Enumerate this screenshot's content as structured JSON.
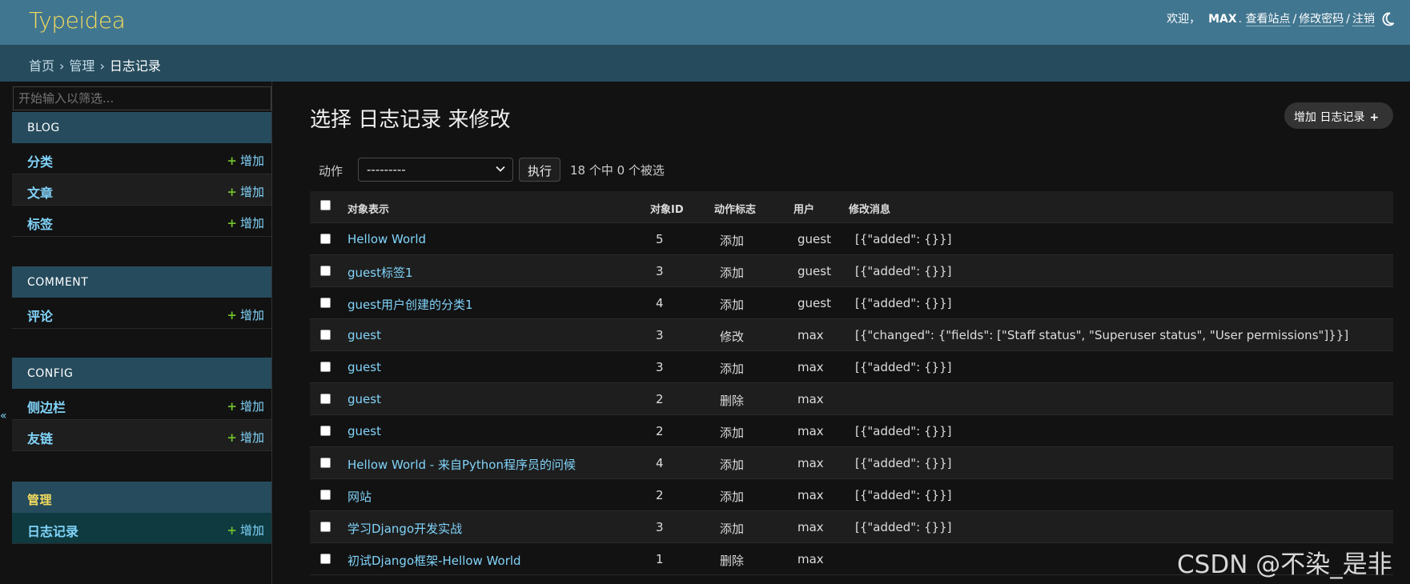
{
  "header": {
    "brand": "Typeidea",
    "welcome": "欢迎，",
    "username": "MAX",
    "view_site": "查看站点",
    "change_password": "修改密码",
    "logout": "注销",
    "sep": "/"
  },
  "breadcrumbs": {
    "home": "首页",
    "admin": "管理",
    "current": "日志记录",
    "arrow": "›"
  },
  "sidebar": {
    "filter_placeholder": "开始输入以筛选...",
    "collapse_glyph": "«",
    "add_label": "增加",
    "plus": "+",
    "modules": [
      {
        "caption": "BLOG",
        "items": [
          {
            "name": "分类"
          },
          {
            "name": "文章"
          },
          {
            "name": "标签"
          }
        ]
      },
      {
        "caption": "COMMENT",
        "items": [
          {
            "name": "评论"
          }
        ]
      },
      {
        "caption": "CONFIG",
        "items": [
          {
            "name": "侧边栏"
          },
          {
            "name": "友链"
          }
        ]
      },
      {
        "caption": "管理",
        "items": [
          {
            "name": "日志记录"
          }
        ]
      }
    ]
  },
  "main": {
    "title": "选择 日志记录 来修改",
    "add_button": "增加 日志记录",
    "add_plus": "+",
    "actions_label": "动作",
    "action_selected": "---------",
    "go_button": "执行",
    "selection_count": "18 个中 0 个被选",
    "columns": [
      "对象表示",
      "对象ID",
      "动作标志",
      "用户",
      "修改消息"
    ],
    "rows": [
      {
        "repr": "Hellow World",
        "id": "5",
        "flag": "添加",
        "user": "guest",
        "msg": "[{\"added\": {}}]"
      },
      {
        "repr": "guest标签1",
        "id": "3",
        "flag": "添加",
        "user": "guest",
        "msg": "[{\"added\": {}}]"
      },
      {
        "repr": "guest用户创建的分类1",
        "id": "4",
        "flag": "添加",
        "user": "guest",
        "msg": "[{\"added\": {}}]"
      },
      {
        "repr": "guest",
        "id": "3",
        "flag": "修改",
        "user": "max",
        "msg": "[{\"changed\": {\"fields\": [\"Staff status\", \"Superuser status\", \"User permissions\"]}}]"
      },
      {
        "repr": "guest",
        "id": "3",
        "flag": "添加",
        "user": "max",
        "msg": "[{\"added\": {}}]"
      },
      {
        "repr": "guest",
        "id": "2",
        "flag": "删除",
        "user": "max",
        "msg": ""
      },
      {
        "repr": "guest",
        "id": "2",
        "flag": "添加",
        "user": "max",
        "msg": "[{\"added\": {}}]"
      },
      {
        "repr": "Hellow World - 来自Python程序员的问候",
        "id": "4",
        "flag": "添加",
        "user": "max",
        "msg": "[{\"added\": {}}]"
      },
      {
        "repr": "网站",
        "id": "2",
        "flag": "添加",
        "user": "max",
        "msg": "[{\"added\": {}}]"
      },
      {
        "repr": "学习Django开发实战",
        "id": "3",
        "flag": "添加",
        "user": "max",
        "msg": "[{\"added\": {}}]"
      },
      {
        "repr": "初试Django框架-Hellow World",
        "id": "1",
        "flag": "删除",
        "user": "max",
        "msg": ""
      }
    ]
  },
  "watermark": "CSDN @不染_是非",
  "icons": {
    "theme": "moon-icon",
    "chevron": "chevron-down-icon",
    "plus": "plus-icon"
  }
}
